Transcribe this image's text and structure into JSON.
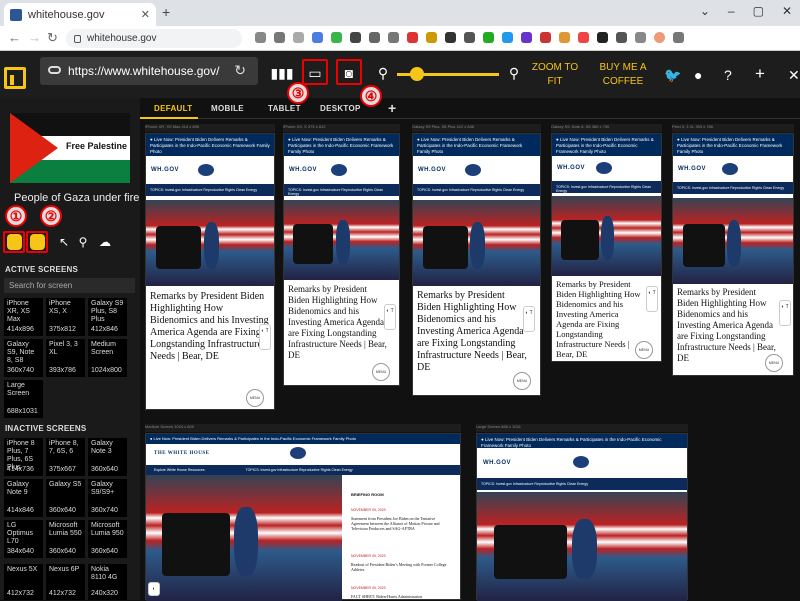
{
  "browser": {
    "tab_title": "whitehouse.gov",
    "url": "whitehouse.gov"
  },
  "app": {
    "url": "https://www.whitehouse.gov/",
    "zoom_to_fit": "ZOOM TO FIT",
    "buy_coffee": "BUY ME A COFFEE",
    "zoom_level": 0.12,
    "markers": [
      "①",
      "②",
      "③",
      "④"
    ],
    "accent": "#f5c518",
    "marker_color": "#e00000"
  },
  "device_tabs": [
    "DEFAULT",
    "MOBILE",
    "TABLET",
    "DESKTOP"
  ],
  "sidebar": {
    "flag_text": "Free Palestine",
    "caption": "People of Gaza under fire",
    "search_placeholder": "Search for screen",
    "active_title": "ACTIVE SCREENS",
    "inactive_title": "INACTIVE SCREENS",
    "active": [
      {
        "name": "iPhone XR, XS Max",
        "size": "414x896"
      },
      {
        "name": "iPhone XS, X",
        "size": "375x812"
      },
      {
        "name": "Galaxy S9 Plus, S8 Plus",
        "size": "412x846"
      },
      {
        "name": "Galaxy S9, Note 8, S8",
        "size": "360x740"
      },
      {
        "name": "Pixel 3, 3 XL",
        "size": "393x786"
      },
      {
        "name": "Medium Screen",
        "size": "1024x800"
      },
      {
        "name": "Large Screen",
        "size": "688x1031"
      }
    ],
    "inactive": [
      {
        "name": "iPhone 8 Plus, 7 Plus, 6S Plus",
        "size": "414x736"
      },
      {
        "name": "iPhone 8, 7, 6S, 6",
        "size": "375x667"
      },
      {
        "name": "Galaxy Note 3",
        "size": "360x640"
      },
      {
        "name": "Galaxy Note 9",
        "size": "414x846"
      },
      {
        "name": "Galaxy S5",
        "size": "360x640"
      },
      {
        "name": "Galaxy S9/S9+",
        "size": "360x740"
      },
      {
        "name": "LG Optimus L70",
        "size": "384x640"
      },
      {
        "name": "Microsoft Lumia 550",
        "size": "360x640"
      },
      {
        "name": "Microsoft Lumia 950",
        "size": "360x640"
      },
      {
        "name": "Nexus 5X",
        "size": "412x732"
      },
      {
        "name": "Nexus 6P",
        "size": "412x732"
      },
      {
        "name": "Nokia 8110 4G",
        "size": "240x320"
      }
    ]
  },
  "preview": {
    "alert": "● Live Now: President Biden Delivers Remarks & Participates in the Indo-Pacific Economic Framework Family Photo",
    "logo": "WH.GOV",
    "logo_full": "THE WHITE HOUSE",
    "topics": "TOPICS:  Invest.gov   Infrastructure   Reproductive Rights   Clean Energy",
    "explore": "Explore White House Resources",
    "headline": "Remarks by President Biden Highlighting How Bidenomics and his Investing America Agenda are Fixing Longstanding Infrastructure Needs | Bear, DE",
    "menu": "MENU",
    "briefing": "BRIEFING ROOM",
    "briefs": [
      {
        "date": "NOVEMBER 09, 2023",
        "text": "Statement from President Joe Biden on the Tentative Agreement between the Alliance of Motion Picture and Television Producers and SAG-AFTRA"
      },
      {
        "date": "NOVEMBER 09, 2023",
        "text": "Readout of President Biden’s Meeting with Former College Athletes"
      },
      {
        "date": "NOVEMBER 09, 2023",
        "text": "FACT SHEET: Biden-Harris Administration"
      }
    ],
    "screens": [
      {
        "label": "iPhone XR, XS Max",
        "size": "414 x 896"
      },
      {
        "label": "iPhone XS, X",
        "size": "375 x 812"
      },
      {
        "label": "Galaxy S9 Plus, S8 Plus",
        "size": "412 x 846"
      },
      {
        "label": "Galaxy S9, Note 8, S8",
        "size": "360 x 740"
      },
      {
        "label": "Pixel 3, 3 XL",
        "size": "393 x 786"
      },
      {
        "label": "Medium Screen",
        "size": "1024 x 800"
      },
      {
        "label": "Large Screen",
        "size": "688 x 1031"
      }
    ]
  }
}
